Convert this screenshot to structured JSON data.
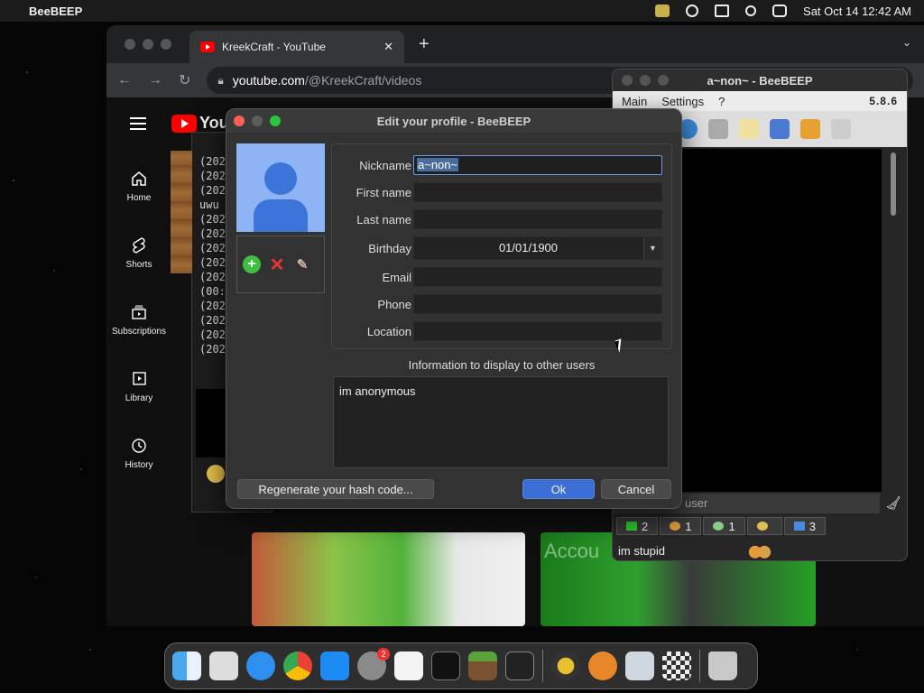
{
  "menubar": {
    "app_name": "BeeBEEP",
    "datetime": "Sat Oct 14  12:42 AM"
  },
  "browser": {
    "tab_title": "KreekCraft - YouTube",
    "url_host": "youtube.com",
    "url_path": "/@KreekCraft/videos",
    "logo_text": "You",
    "sidebar": [
      {
        "label": "Home",
        "icon": "home-icon"
      },
      {
        "label": "Shorts",
        "icon": "shorts-icon"
      },
      {
        "label": "Subscriptions",
        "icon": "subscriptions-icon"
      },
      {
        "label": "Library",
        "icon": "library-icon"
      },
      {
        "label": "History",
        "icon": "history-icon"
      }
    ],
    "thumb2_text": "Accou"
  },
  "bg_terminal": {
    "lines": [
      "(202",
      "(202",
      "(202",
      "uwu",
      "(202",
      "(202",
      "(202",
      "(202",
      "(202",
      "(00:3",
      "(202",
      "(202",
      "(202",
      "(202"
    ]
  },
  "beebeep": {
    "title": "a~non~ - BeeBEEP",
    "menu": [
      "Main",
      "Settings",
      "?"
    ],
    "version": "5.8.6",
    "search_placeholder": "user",
    "status": [
      {
        "icon": "computer-icon",
        "count": "2"
      },
      {
        "icon": "users-icon",
        "count": "1"
      },
      {
        "icon": "chat-icon",
        "count": "1"
      },
      {
        "icon": "group-icon",
        "count": ""
      },
      {
        "icon": "files-icon",
        "count": "3"
      }
    ],
    "status_message": "im stupid"
  },
  "profile_dialog": {
    "title": "Edit your profile - BeeBEEP",
    "fields": {
      "nickname_label": "Nickname",
      "nickname_value": "a~non~",
      "first_name_label": "First name",
      "first_name_value": "",
      "last_name_label": "Last name",
      "last_name_value": "",
      "birthday_label": "Birthday",
      "birthday_value": "01/01/1900",
      "email_label": "Email",
      "email_value": "",
      "phone_label": "Phone",
      "phone_value": "",
      "location_label": "Location",
      "location_value": ""
    },
    "info_label": "Information to display to other users",
    "info_value": "im anonymous",
    "regenerate_label": "Regenerate your hash code...",
    "ok_label": "Ok",
    "cancel_label": "Cancel"
  },
  "dock": {
    "items": [
      "finder",
      "launchpad",
      "safari",
      "chrome",
      "app-store",
      "system-settings",
      "textedit",
      "terminal",
      "minecraft",
      "beebeep-alt",
      "beebeep",
      "downloads",
      "settings-gear",
      "chess",
      "trash"
    ],
    "system_settings_badge": "2"
  }
}
